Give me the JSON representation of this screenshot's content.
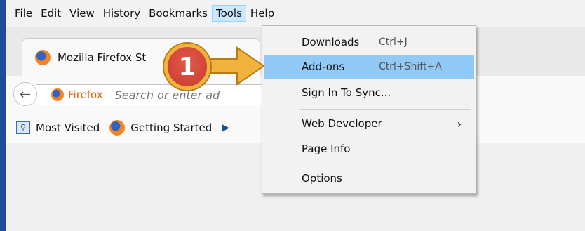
{
  "menubar": {
    "items": [
      "File",
      "Edit",
      "View",
      "History",
      "Bookmarks",
      "Tools",
      "Help"
    ],
    "active": "Tools"
  },
  "tab": {
    "title": "Mozilla Firefox St",
    "icon": "firefox-logo-icon"
  },
  "navbar": {
    "identity_label": "Firefox",
    "url_placeholder": "Search or enter ad"
  },
  "bookmarks": {
    "items": [
      {
        "label": "Most Visited",
        "icon": "most-visited-icon"
      },
      {
        "label": "Getting Started",
        "icon": "firefox-logo-icon"
      }
    ]
  },
  "tools_menu": {
    "items": [
      {
        "label": "Downloads",
        "shortcut": "Ctrl+J",
        "highlighted": false
      },
      {
        "label": "Add-ons",
        "shortcut": "Ctrl+Shift+A",
        "highlighted": true
      },
      {
        "label": "Sign In To Sync...",
        "shortcut": "",
        "highlighted": false
      },
      {
        "label": "Web Developer",
        "shortcut": "",
        "submenu": true,
        "highlighted": false
      },
      {
        "label": "Page Info",
        "shortcut": "",
        "highlighted": false
      },
      {
        "label": "Options",
        "shortcut": "",
        "highlighted": false
      }
    ]
  },
  "annotation": {
    "step_number": "1",
    "color": "#c93a2e",
    "arrow_color": "#f3b23c"
  },
  "colors": {
    "highlight": "#91c9f7",
    "frame": "#1e4aa0",
    "identity": "#e36510"
  }
}
